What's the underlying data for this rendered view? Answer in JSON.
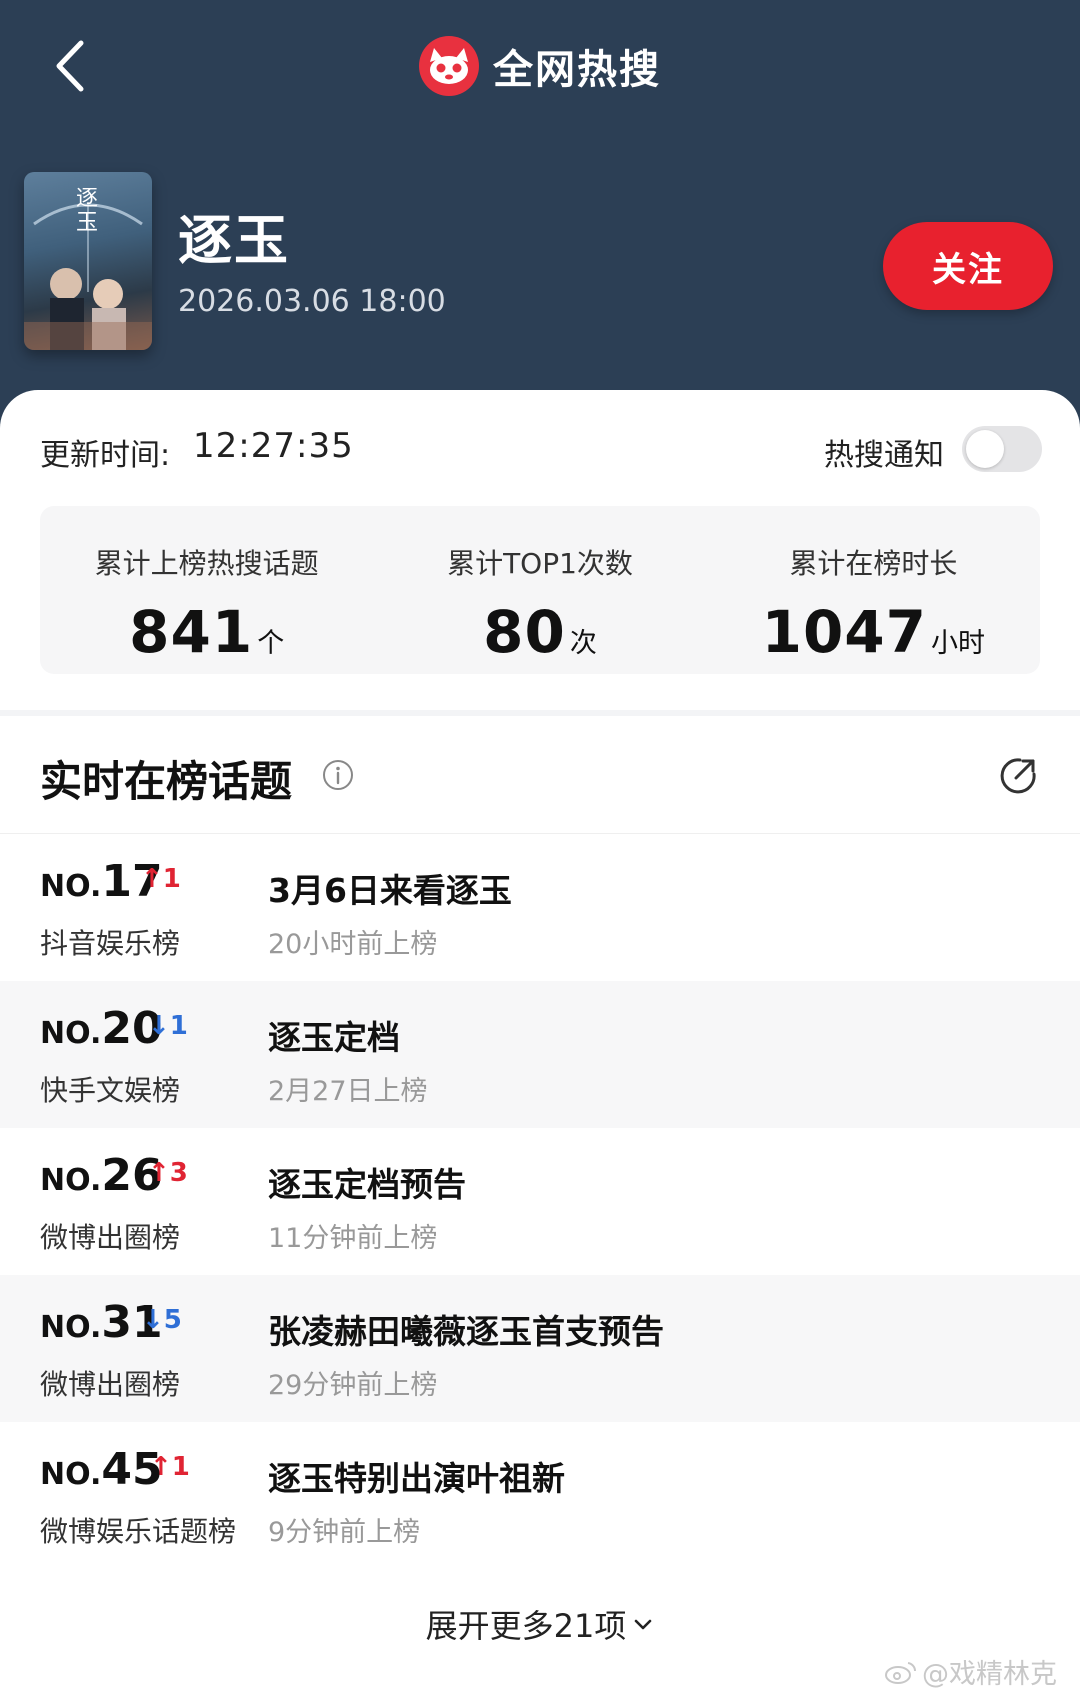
{
  "nav": {
    "title": "全网热搜"
  },
  "show": {
    "name": "逐玉",
    "air_time": "2026.03.06 18:00",
    "follow_label": "关注",
    "poster_title": "逐玉"
  },
  "summary": {
    "update_label": "更新时间:",
    "update_time": "12:27:35",
    "notify_label": "热搜通知",
    "notify_enabled": false,
    "stats": [
      {
        "label": "累计上榜热搜话题",
        "value": "841",
        "unit": "个"
      },
      {
        "label": "累计TOP1次数",
        "value": "80",
        "unit": "次"
      },
      {
        "label": "累计在榜时长",
        "value": "1047",
        "unit": "小时"
      }
    ]
  },
  "list": {
    "title": "实时在榜话题",
    "items": [
      {
        "no_prefix": "NO.",
        "rank": "17",
        "change": "↑1",
        "direction": "up",
        "board": "抖音娱乐榜",
        "topic": "3月6日来看逐玉",
        "when": "20小时前上榜"
      },
      {
        "no_prefix": "NO.",
        "rank": "20",
        "change": "↓1",
        "direction": "down",
        "board": "快手文娱榜",
        "topic": "逐玉定档",
        "when": "2月27日上榜"
      },
      {
        "no_prefix": "NO.",
        "rank": "26",
        "change": "↑3",
        "direction": "up",
        "board": "微博出圈榜",
        "topic": "逐玉定档预告",
        "when": "11分钟前上榜"
      },
      {
        "no_prefix": "NO.",
        "rank": "31",
        "change": "↓5",
        "direction": "down",
        "board": "微博出圈榜",
        "topic": "张凌赫田曦薇逐玉首支预告",
        "when": "29分钟前上榜"
      },
      {
        "no_prefix": "NO.",
        "rank": "45",
        "change": "↑1",
        "direction": "up",
        "board": "微博娱乐话题榜",
        "topic": "逐玉特别出演叶祖新",
        "when": "9分钟前上榜"
      }
    ],
    "expand_label": "展开更多21项"
  },
  "watermark": "@戏精林克",
  "colors": {
    "header": "#2c3f55",
    "accent_red": "#e8212e",
    "up": "#e02433",
    "down": "#2f6fd6"
  }
}
